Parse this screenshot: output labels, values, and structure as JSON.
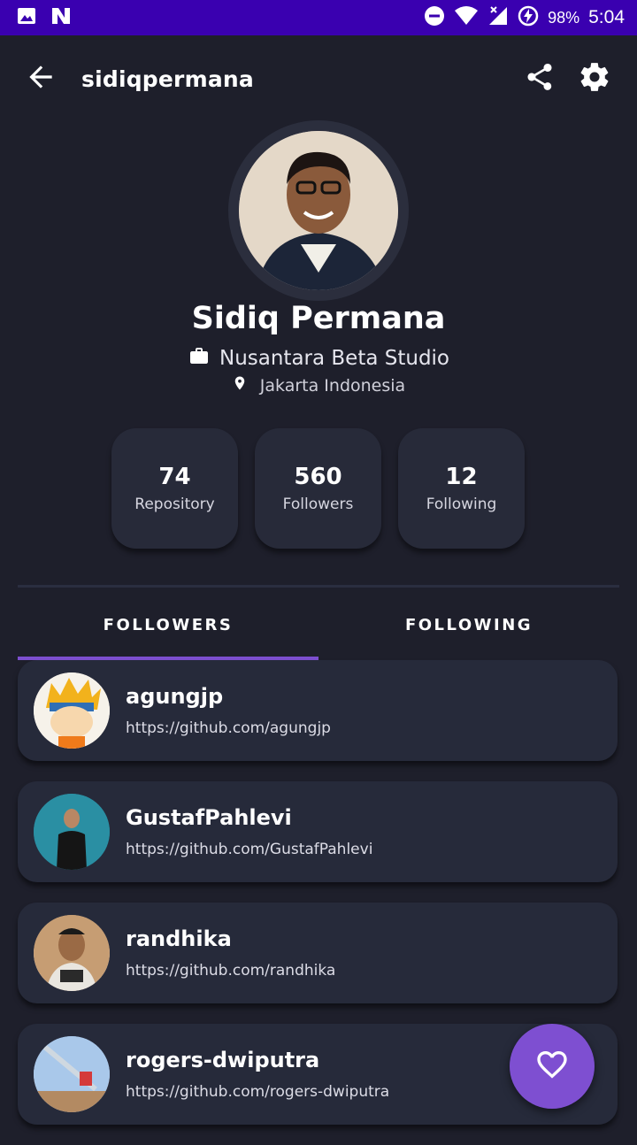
{
  "status_bar": {
    "battery": "98%",
    "time": "5:04",
    "icons": [
      "image-icon",
      "n-icon",
      "dnd-icon",
      "wifi-icon",
      "signal-icon",
      "battery-charging-icon"
    ]
  },
  "app_bar": {
    "title": "sidiqpermana",
    "icons": [
      "back-arrow-icon",
      "share-icon",
      "gear-icon"
    ]
  },
  "profile": {
    "name": "Sidiq Permana",
    "company": "Nusantara Beta Studio",
    "location": "Jakarta Indonesia"
  },
  "stats": [
    {
      "value": "74",
      "label": "Repository"
    },
    {
      "value": "560",
      "label": "Followers"
    },
    {
      "value": "12",
      "label": "Following"
    }
  ],
  "tabs": [
    {
      "label": "FOLLOWERS",
      "active": true
    },
    {
      "label": "FOLLOWING",
      "active": false
    }
  ],
  "users": [
    {
      "login": "agungjp",
      "url": "https://github.com/agungjp"
    },
    {
      "login": "GustafPahlevi",
      "url": "https://github.com/GustafPahlevi"
    },
    {
      "login": "randhika",
      "url": "https://github.com/randhika"
    },
    {
      "login": "rogers-dwiputra",
      "url": "https://github.com/rogers-dwiputra"
    }
  ],
  "colors": {
    "status_bar": "#3a00b0",
    "background": "#1e1f2b",
    "card": "#262a3a",
    "accent": "#7e4fd1"
  }
}
